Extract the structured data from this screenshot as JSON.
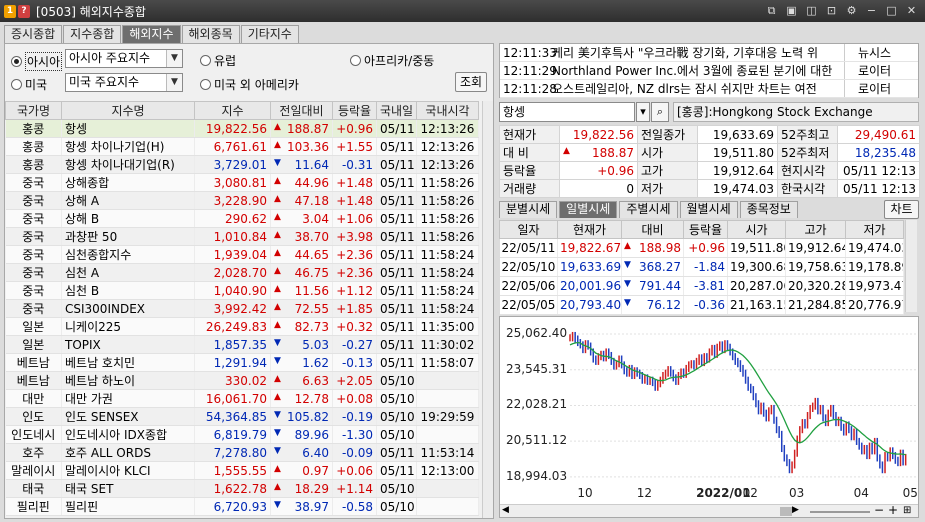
{
  "window": {
    "badge1": "1",
    "badge2": "?",
    "title": "[0503] 해외지수종합",
    "badge1_color": "#f0a000",
    "badge2_color": "#d04040"
  },
  "tabs": [
    "증시종합",
    "지수종합",
    "해외지수",
    "해외종목",
    "기타지수"
  ],
  "filters": {
    "asia": "아시아",
    "asia_select": "아시아 주요지수",
    "europe": "유럽",
    "africa": "아프리카/중동",
    "usa": "미국",
    "usa_select": "미국 주요지수",
    "other_america": "미국 외 아메리카",
    "query_btn": "조회"
  },
  "market_table": {
    "headers": [
      "국가명",
      "지수명",
      "지수",
      "전일대비",
      "등락율",
      "국내일",
      "국내시각"
    ],
    "rows": [
      {
        "country": "홍콩",
        "name": "항셍",
        "value": "19,822.56",
        "dir": "up",
        "change": "188.87",
        "rate": "+0.96",
        "date": "05/11",
        "time": "12:13:26"
      },
      {
        "country": "홍콩",
        "name": "항셍 차이나기업(H)",
        "value": "6,761.61",
        "dir": "up",
        "change": "103.36",
        "rate": "+1.55",
        "date": "05/11",
        "time": "12:13:26"
      },
      {
        "country": "홍콩",
        "name": "항셍 차이나대기업(R)",
        "value": "3,729.01",
        "dir": "dn",
        "change": "11.64",
        "rate": "-0.31",
        "date": "05/11",
        "time": "12:13:26"
      },
      {
        "country": "중국",
        "name": "상해종합",
        "value": "3,080.81",
        "dir": "up",
        "change": "44.96",
        "rate": "+1.48",
        "date": "05/11",
        "time": "11:58:26"
      },
      {
        "country": "중국",
        "name": "상해 A",
        "value": "3,228.90",
        "dir": "up",
        "change": "47.18",
        "rate": "+1.48",
        "date": "05/11",
        "time": "11:58:26"
      },
      {
        "country": "중국",
        "name": "상해 B",
        "value": "290.62",
        "dir": "up",
        "change": "3.04",
        "rate": "+1.06",
        "date": "05/11",
        "time": "11:58:26"
      },
      {
        "country": "중국",
        "name": "과창판 50",
        "value": "1,010.84",
        "dir": "up",
        "change": "38.70",
        "rate": "+3.98",
        "date": "05/11",
        "time": "11:58:26"
      },
      {
        "country": "중국",
        "name": "심천종합지수",
        "value": "1,939.04",
        "dir": "up",
        "change": "44.65",
        "rate": "+2.36",
        "date": "05/11",
        "time": "11:58:24"
      },
      {
        "country": "중국",
        "name": "심천 A",
        "value": "2,028.70",
        "dir": "up",
        "change": "46.75",
        "rate": "+2.36",
        "date": "05/11",
        "time": "11:58:24"
      },
      {
        "country": "중국",
        "name": "심천 B",
        "value": "1,040.90",
        "dir": "up",
        "change": "11.56",
        "rate": "+1.12",
        "date": "05/11",
        "time": "11:58:24"
      },
      {
        "country": "중국",
        "name": "CSI300INDEX",
        "value": "3,992.42",
        "dir": "up",
        "change": "72.55",
        "rate": "+1.85",
        "date": "05/11",
        "time": "11:58:24"
      },
      {
        "country": "일본",
        "name": "니케이225",
        "value": "26,249.83",
        "dir": "up",
        "change": "82.73",
        "rate": "+0.32",
        "date": "05/11",
        "time": "11:35:00"
      },
      {
        "country": "일본",
        "name": "TOPIX",
        "value": "1,857.35",
        "dir": "dn",
        "change": "5.03",
        "rate": "-0.27",
        "date": "05/11",
        "time": "11:30:02"
      },
      {
        "country": "베트남",
        "name": "베트남 호치민",
        "value": "1,291.94",
        "dir": "dn",
        "change": "1.62",
        "rate": "-0.13",
        "date": "05/11",
        "time": "11:58:07"
      },
      {
        "country": "베트남",
        "name": "베트남 하노이",
        "value": "330.02",
        "dir": "up",
        "change": "6.63",
        "rate": "+2.05",
        "date": "05/10",
        "time": ""
      },
      {
        "country": "대만",
        "name": "대만 가권",
        "value": "16,061.70",
        "dir": "up",
        "change": "12.78",
        "rate": "+0.08",
        "date": "05/10",
        "time": ""
      },
      {
        "country": "인도",
        "name": "인도 SENSEX",
        "value": "54,364.85",
        "dir": "dn",
        "change": "105.82",
        "rate": "-0.19",
        "date": "05/10",
        "time": "19:29:59"
      },
      {
        "country": "인도네시",
        "name": "인도네시아 IDX종합",
        "value": "6,819.79",
        "dir": "dn",
        "change": "89.96",
        "rate": "-1.30",
        "date": "05/10",
        "time": ""
      },
      {
        "country": "호주",
        "name": "호주 ALL ORDS",
        "value": "7,278.80",
        "dir": "dn",
        "change": "6.40",
        "rate": "-0.09",
        "date": "05/11",
        "time": "11:53:14"
      },
      {
        "country": "말레이시",
        "name": "말레이시아 KLCI",
        "value": "1,555.55",
        "dir": "up",
        "change": "0.97",
        "rate": "+0.06",
        "date": "05/11",
        "time": "12:13:00"
      },
      {
        "country": "태국",
        "name": "태국 SET",
        "value": "1,622.78",
        "dir": "up",
        "change": "18.29",
        "rate": "+1.14",
        "date": "05/10",
        "time": ""
      },
      {
        "country": "필리핀",
        "name": "필리핀",
        "value": "6,720.93",
        "dir": "dn",
        "change": "38.97",
        "rate": "-0.58",
        "date": "05/10",
        "time": ""
      }
    ]
  },
  "news": [
    {
      "time": "12:11:33",
      "headline": "케리 美기후특사 \"우크라戰 장기화, 기후대응 노력 위",
      "source": "뉴시스"
    },
    {
      "time": "12:11:29",
      "headline": "Northland Power Inc.에서 3월에 종료된 분기에 대한",
      "source": "로이터"
    },
    {
      "time": "12:11:28",
      "headline": "오스트레일리아, NZ dlrs는 잠시 쉬지만 차트는 여전",
      "source": "로이터"
    }
  ],
  "search": {
    "value": "항셍",
    "exchange": "[홍콩]:Hongkong Stock Exchange"
  },
  "quote": {
    "current_label": "현재가",
    "current": "19,822.56",
    "prev_close_label": "전일종가",
    "prev_close": "19,633.69",
    "high52_label": "52주최고",
    "high52": "29,490.61",
    "change_label": "대 비",
    "change": "188.87",
    "open_label": "시가",
    "open": "19,511.80",
    "low52_label": "52주최저",
    "low52": "18,235.48",
    "rate_label": "등락율",
    "rate": "+0.96",
    "high_label": "고가",
    "high": "19,912.64",
    "local_time_label": "현지시각",
    "local_time": "05/11 12:13",
    "volume_label": "거래량",
    "volume": "0",
    "low_label": "저가",
    "low": "19,474.03",
    "kr_time_label": "한국시각",
    "kr_time": "05/11 12:13"
  },
  "subtabs": [
    "분별시세",
    "일별시세",
    "주별시세",
    "월별시세",
    "종목정보"
  ],
  "chart_btn": "차트",
  "daily": {
    "headers": [
      "일자",
      "현재가",
      "대비",
      "등락율",
      "시가",
      "고가",
      "저가"
    ],
    "rows": [
      {
        "date": "22/05/11",
        "close": "19,822.67",
        "dir": "up",
        "change": "188.98",
        "rate": "+0.96",
        "open": "19,511.80",
        "high": "19,912.64",
        "low": "19,474.03"
      },
      {
        "date": "22/05/10",
        "close": "19,633.69",
        "dir": "dn",
        "change": "368.27",
        "rate": "-1.84",
        "open": "19,300.68",
        "high": "19,758.63",
        "low": "19,178.89"
      },
      {
        "date": "22/05/06",
        "close": "20,001.96",
        "dir": "dn",
        "change": "791.44",
        "rate": "-3.81",
        "open": "20,287.06",
        "high": "20,320.28",
        "low": "19,973.47"
      },
      {
        "date": "22/05/05",
        "close": "20,793.40",
        "dir": "dn",
        "change": "76.12",
        "rate": "-0.36",
        "open": "21,163.15",
        "high": "21,284.85",
        "low": "20,776.97"
      }
    ]
  },
  "chart_data": {
    "type": "line",
    "y_ticks": [
      "25,062.40",
      "23,545.31",
      "22,028.21",
      "20,511.12",
      "18,994.03"
    ],
    "y_tick_values": [
      25062.4,
      23545.31,
      22028.21,
      20511.12,
      18994.03
    ],
    "ylim": [
      18650,
      25700
    ],
    "x_ticks": [
      "10",
      "12",
      "2022/01",
      "02",
      "03",
      "04",
      "05"
    ],
    "x_tick_positions": [
      4,
      27,
      50,
      68,
      86,
      111,
      130
    ],
    "x_range": [
      0,
      134
    ],
    "series": [
      {
        "color": "#d02020",
        "values": [
          24900,
          25000,
          24850,
          24700,
          24600,
          24400,
          24650,
          24550,
          24300,
          24000,
          23900,
          24100,
          24200,
          24050,
          24300,
          24150,
          23900,
          23700,
          23800,
          24000,
          23750,
          23500,
          23400,
          23600,
          23300,
          23500,
          23400,
          23300,
          23100,
          23200,
          23050,
          23100,
          23000,
          22800,
          22950,
          23100,
          23300,
          23400,
          23550,
          23400,
          23200,
          23050,
          23300,
          23450,
          23350,
          23600,
          23750,
          23800,
          23700,
          23900,
          24050,
          23850,
          24100,
          24000,
          24300,
          24450,
          24200,
          24500,
          24600,
          24400,
          24650,
          24500,
          24300,
          24100,
          23900,
          23800,
          23600,
          23400,
          23100,
          22800,
          22700,
          22400,
          22100,
          21800,
          22000,
          21700,
          21500,
          21800,
          21900,
          21400,
          21000,
          20800,
          20200,
          19800,
          19600,
          19300,
          19500,
          20000,
          20600,
          21000,
          21300,
          21200,
          21600,
          21900,
          22000,
          22200,
          21800,
          21900,
          21500,
          21300,
          21700,
          21900,
          21600,
          21300,
          21400,
          21100,
          20900,
          21200,
          21000,
          20700,
          20900,
          20500,
          20300,
          20100,
          20200,
          19900,
          20300,
          20100,
          20500,
          19800,
          19500,
          19300,
          19900,
          19800,
          20100,
          19900,
          19700,
          19600,
          20001,
          19630,
          19820
        ]
      },
      {
        "color": "#20a040",
        "values": [
          24600,
          24650,
          24680,
          24700,
          24680,
          24600,
          24560,
          24520,
          24450,
          24350,
          24250,
          24200,
          24150,
          24120,
          24110,
          24100,
          24050,
          23980,
          23920,
          23880,
          23820,
          23750,
          23680,
          23620,
          23550,
          23500,
          23470,
          23430,
          23380,
          23330,
          23280,
          23240,
          23200,
          23140,
          23100,
          23080,
          23090,
          23110,
          23160,
          23200,
          23220,
          23230,
          23240,
          23260,
          23290,
          23330,
          23380,
          23440,
          23500,
          23570,
          23640,
          23710,
          23780,
          23840,
          23910,
          23980,
          24050,
          24120,
          24200,
          24260,
          24320,
          24360,
          24380,
          24380,
          24350,
          24300,
          24230,
          24150,
          24040,
          23920,
          23780,
          23620,
          23450,
          23270,
          23090,
          22910,
          22730,
          22560,
          22410,
          22250,
          22080,
          21880,
          21660,
          21420,
          21170,
          20930,
          20720,
          20560,
          20470,
          20440,
          20480,
          20560,
          20670,
          20800,
          20940,
          21060,
          21160,
          21250,
          21300,
          21330,
          21360,
          21390,
          21420,
          21430,
          21430,
          21410,
          21370,
          21320,
          21270,
          21200,
          21130,
          21040,
          20950,
          20850,
          20760,
          20660,
          20580,
          20500,
          20440,
          20370,
          20280,
          20180,
          20100,
          20040,
          20010,
          19990,
          19970,
          19960,
          19970,
          19950,
          19940
        ]
      }
    ]
  }
}
